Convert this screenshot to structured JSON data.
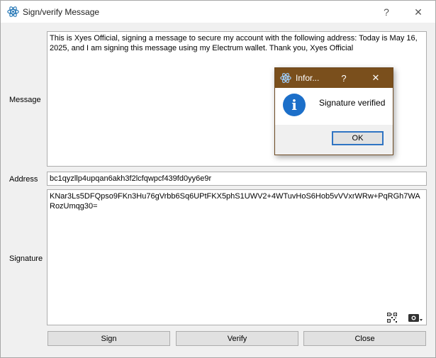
{
  "window": {
    "title": "Sign/verify Message",
    "help_glyph": "?",
    "close_glyph": "✕"
  },
  "form": {
    "message_label": "Message",
    "message_value": "This is Xyes Official, signing a message to secure my account with the following address: Today is May 16, 2025, and I am signing this message using my Electrum wallet. Thank you, Xyes Official",
    "address_label": "Address",
    "address_value": "bc1qyzllp4upqan6akh3f2lcfqwpcf439fd0yy6e9r",
    "signature_label": "Signature",
    "signature_value": "KNar3Ls5DFQpso9FKn3Hu76gVrbb6Sq6UPtFKX5phS1UWV2+4WTuvHoS6Hob5vVVxrWRw+PqRGh7WARozUmqg30="
  },
  "buttons": {
    "sign": "Sign",
    "verify": "Verify",
    "close": "Close"
  },
  "dialog": {
    "title": "Infor...",
    "help_glyph": "?",
    "close_glyph": "✕",
    "message": "Signature verified",
    "info_glyph": "i",
    "ok": "OK"
  },
  "icons": [
    "electrum-logo-icon",
    "qr-code-icon",
    "camera-icon",
    "info-icon"
  ],
  "colors": {
    "dialog_titlebar": "#7a4f1c",
    "info_icon": "#1c6fc9",
    "ok_focus_border": "#2f74c3"
  }
}
